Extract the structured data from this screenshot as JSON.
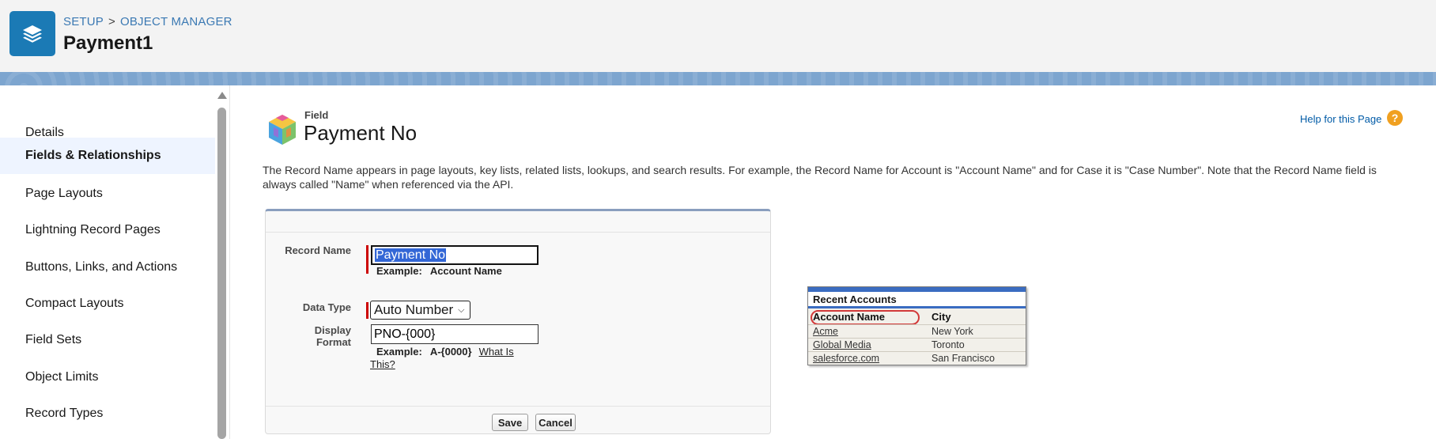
{
  "header": {
    "breadcrumb": [
      "SETUP",
      "OBJECT MANAGER"
    ],
    "breadcrumb_sep": ">",
    "title": "Payment1",
    "icon": "layers-icon"
  },
  "sidebar": {
    "items": [
      {
        "label": "Details",
        "active": false
      },
      {
        "label": "Fields & Relationships",
        "active": true
      },
      {
        "label": "Page Layouts",
        "active": false
      },
      {
        "label": "Lightning Record Pages",
        "active": false
      },
      {
        "label": "Buttons, Links, and Actions",
        "active": false
      },
      {
        "label": "Compact Layouts",
        "active": false
      },
      {
        "label": "Field Sets",
        "active": false
      },
      {
        "label": "Object Limits",
        "active": false
      },
      {
        "label": "Record Types",
        "active": false
      }
    ]
  },
  "main": {
    "field_label": "Field",
    "field_title": "Payment No",
    "help_link": "Help for this Page",
    "help_icon": "?",
    "description": "The Record Name appears in page layouts, key lists, related lists, lookups, and search results. For example, the Record Name for Account is \"Account Name\" and for Case it is \"Case Number\". Note that the Record Name field is always called \"Name\" when referenced via the API."
  },
  "form": {
    "record_name_label": "Record Name",
    "record_name_value": "Payment No",
    "record_name_example_label": "Example:",
    "record_name_example_value": "Account Name",
    "data_type_label": "Data Type",
    "data_type_value": "Auto Number",
    "display_format_label_1": "Display",
    "display_format_label_2": "Format",
    "display_format_value": "PNO-{000}",
    "display_format_example_label": "Example:",
    "display_format_example_value": "A-{0000}",
    "what_is_this_1": "What Is",
    "what_is_this_2": "This?",
    "save_label": "Save",
    "cancel_label": "Cancel"
  },
  "recent_accounts": {
    "title": "Recent Accounts",
    "columns": [
      "Account Name",
      "City"
    ],
    "rows": [
      [
        "Acme",
        "New York"
      ],
      [
        "Global Media",
        "Toronto"
      ],
      [
        "salesforce.com",
        "San Francisco"
      ]
    ]
  },
  "colors": {
    "brand": "#1b7ab5",
    "link": "#3b79b3",
    "required": "#cc0000",
    "selection": "#3367d6"
  }
}
